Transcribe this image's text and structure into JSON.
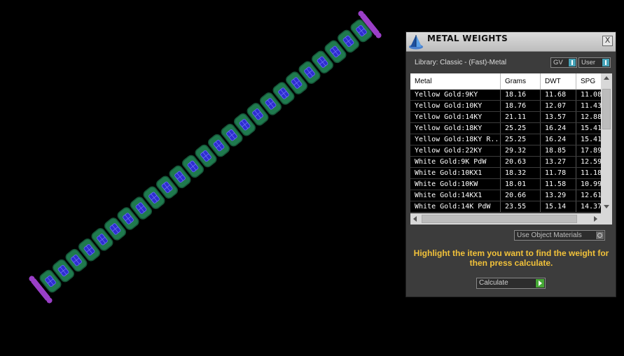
{
  "viewport": {
    "model_name": "bracelet-model",
    "link_count": 25
  },
  "panel": {
    "title": "METAL WEIGHTS",
    "close_label": "X",
    "library_label": "Library: Classic - (Fast)-Metal",
    "gv_label": "GV",
    "user_label": "User",
    "table": {
      "headers": [
        "Metal",
        "Grams",
        "DWT",
        "SPG"
      ],
      "rows": [
        [
          "Yellow Gold:9KY",
          "18.16",
          "11.68",
          "11.08"
        ],
        [
          "Yellow Gold:10KY",
          "18.76",
          "12.07",
          "11.43"
        ],
        [
          "Yellow Gold:14KY",
          "21.11",
          "13.57",
          "12.88"
        ],
        [
          "Yellow Gold:18KY",
          "25.25",
          "16.24",
          "15.41"
        ],
        [
          "Yellow Gold:18KY R...",
          "25.25",
          "16.24",
          "15.41"
        ],
        [
          "Yellow Gold:22KY",
          "29.32",
          "18.85",
          "17.89"
        ],
        [
          "White Gold:9K PdW",
          "20.63",
          "13.27",
          "12.59"
        ],
        [
          "White Gold:10KX1",
          "18.32",
          "11.78",
          "11.18"
        ],
        [
          "White Gold:10KW",
          "18.01",
          "11.58",
          "10.99"
        ],
        [
          "White Gold:14KX1",
          "20.66",
          "13.29",
          "12.61"
        ],
        [
          "White Gold:14K PdW",
          "23.55",
          "15.14",
          "14.37"
        ]
      ]
    },
    "use_object_materials_label": "Use Object Materials",
    "message": "Highlight the item you want to find the weight for then press calculate.",
    "calculate_label": "Calculate"
  },
  "colors": {
    "link_green": "#1f7a4e",
    "link_dark": "#155437",
    "gem_blue": "#2e2ed0",
    "clasp_purple": "#9a3fc7",
    "message_yellow": "#f2c23a",
    "indicator_blue": "#46a3b8",
    "indicator_green": "#46a836"
  }
}
